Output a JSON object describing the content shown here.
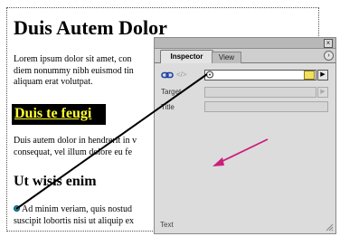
{
  "document": {
    "heading": "Duis Autem Dolor",
    "para1": [
      "Lorem ipsum dolor sit amet, con",
      "diem nonummy nibh euismod tin",
      "aliquam erat volutpat."
    ],
    "link_text": "Duis te feugi",
    "para2": [
      "Duis autem dolor in hendrerit in v",
      "consequat, vel illum dolore eu fe"
    ],
    "subheading": "Ut wisis enim",
    "para3": [
      "Ad minim veriam, quis nostud",
      "suscipit lobortis nisi ut aliquip ex"
    ]
  },
  "inspector": {
    "tabs": [
      "Inspector",
      "View"
    ],
    "active_tab": "Inspector",
    "fields": {
      "target_label": "Target",
      "title_label": "Title"
    },
    "status": "Text"
  },
  "colors": {
    "link": "#ffff33",
    "selection": "#000000",
    "arrow": "#cc1f7a",
    "anchor": "#1a8fb0"
  }
}
